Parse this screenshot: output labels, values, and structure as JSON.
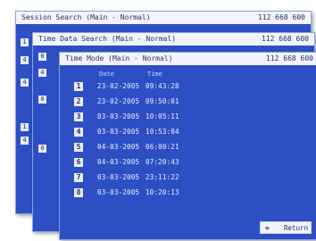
{
  "windows": {
    "back1": {
      "title_left": "Session Search (Main - Normal)",
      "title_right": "112 668 600"
    },
    "back2": {
      "title_left": "Time Data Search (Main - Normal)",
      "title_right": "112 668 600"
    },
    "front": {
      "title_left": "Time Mode (Main - Normal)",
      "title_right": "112 668 600"
    }
  },
  "back1_side": [
    "1",
    "4",
    "4",
    "1",
    "4"
  ],
  "back2_side": [
    "0",
    "4",
    "0",
    "0"
  ],
  "columns": {
    "date": "Date",
    "time": "Time"
  },
  "rows": [
    {
      "n": "1",
      "date": "23-02-2005",
      "time": "09:43:28"
    },
    {
      "n": "2",
      "date": "23-02-2005",
      "time": "09:50:01"
    },
    {
      "n": "3",
      "date": "03-03-2005",
      "time": "10:05:11"
    },
    {
      "n": "4",
      "date": "03-03-2005",
      "time": "10:53:04"
    },
    {
      "n": "5",
      "date": "04-03-2005",
      "time": "06:00:21"
    },
    {
      "n": "6",
      "date": "04-03-2005",
      "time": "07:20:43"
    },
    {
      "n": "7",
      "date": "03-03-2005",
      "time": "23:11:22"
    },
    {
      "n": "8",
      "date": "03-03-2005",
      "time": "10:20:13"
    }
  ],
  "return_button": {
    "icon": "≡",
    "label": "Return"
  }
}
